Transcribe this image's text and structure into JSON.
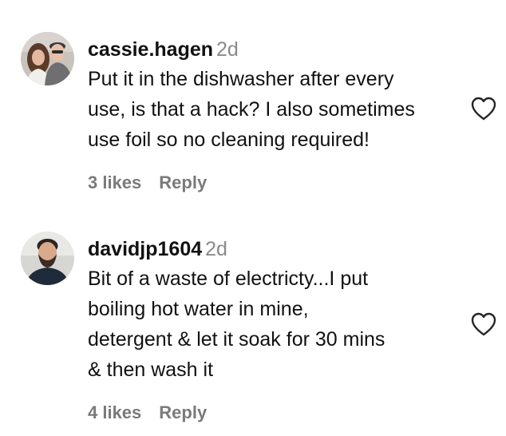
{
  "comments": [
    {
      "username": "cassie.hagen",
      "time": "2d",
      "text_lines": [
        "Put it in the dishwasher after every",
        "use, is that a hack? I also sometimes",
        "use foil so no cleaning required!"
      ],
      "likes": "3 likes",
      "reply_label": "Reply",
      "like_icon": "heart-outline-icon"
    },
    {
      "username": "davidjp1604",
      "time": "2d",
      "text_lines": [
        "Bit of a waste of electricty...I put",
        "boiling hot water in mine,",
        "detergent & let it soak for 30 mins",
        "& then wash it"
      ],
      "likes": "4 likes",
      "reply_label": "Reply",
      "like_icon": "heart-outline-icon"
    }
  ],
  "colors": {
    "text": "#111111",
    "muted": "#8a8a8a",
    "heart_outline": "#262626"
  }
}
